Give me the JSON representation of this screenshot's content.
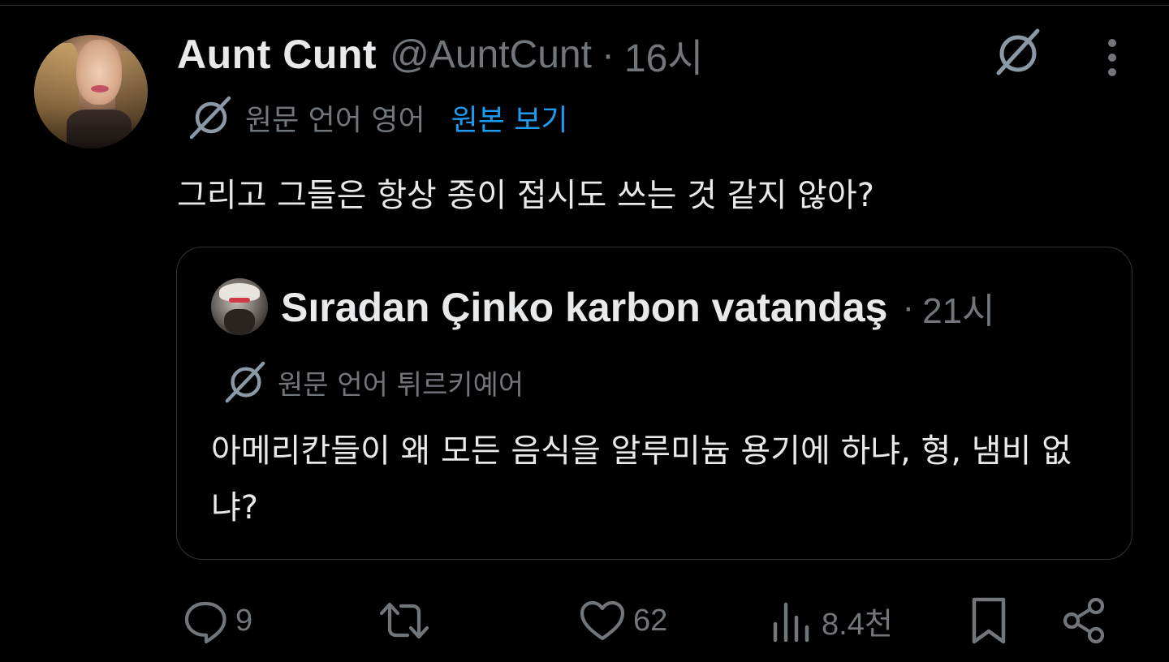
{
  "tweet": {
    "display_name": "Aunt Cunt",
    "handle": "@AuntCunt",
    "separator": "·",
    "time": "16시",
    "translation": {
      "source_label": "원문 언어 영어",
      "show_original_label": "원본 보기"
    },
    "text": "그리고 그들은 항상 종이 접시도 쓰는 것 같지 않아?",
    "icons": {
      "translate": "translate-icon",
      "more": "more-icon",
      "avatar": "avatar"
    }
  },
  "quote": {
    "display_name": "Sıradan Çinko karbon vatandaş",
    "separator": "·",
    "time": "21시",
    "translation": {
      "source_label": "원문 언어 튀르키예어"
    },
    "text": "아메리칸들이 왜 모든 음식을 알루미늄 용기에 하냐, 형, 냄비 없냐?"
  },
  "actions": {
    "reply": {
      "icon": "reply-icon",
      "count": "9"
    },
    "retweet": {
      "icon": "retweet-icon",
      "count": ""
    },
    "like": {
      "icon": "heart-icon",
      "count": "62"
    },
    "views": {
      "icon": "views-icon",
      "count": "8.4천"
    },
    "bookmark": {
      "icon": "bookmark-icon"
    },
    "share": {
      "icon": "share-icon"
    }
  },
  "colors": {
    "background": "#000000",
    "primary_text": "#e7e9ea",
    "secondary_text": "#71767b",
    "link": "#1d9bf0",
    "border": "#2f3336"
  }
}
